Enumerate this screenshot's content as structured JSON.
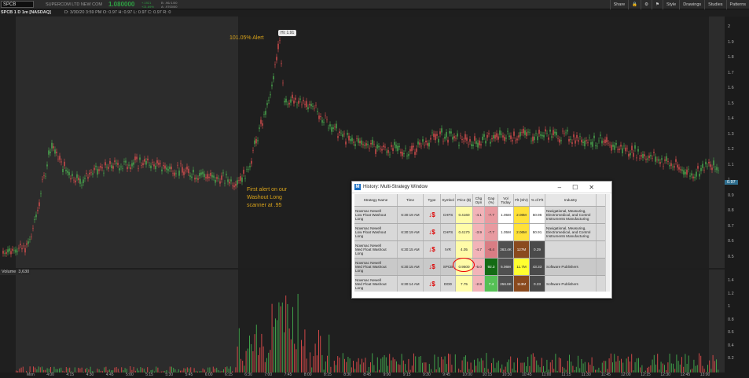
{
  "topbar": {
    "symbol": "SPCB",
    "company": "SUPERCOM LTD NEW COM",
    "price": "1.080000",
    "change_line1": "+.1921",
    "change_line2": "+21.69%",
    "extra_line1": "B: .96/.1/00",
    "extra_line2": "A: .9700/00",
    "tools": [
      "Share",
      "",
      "",
      "",
      "Style",
      "Drawings",
      "Studies",
      "Patterns"
    ]
  },
  "info": {
    "title": "SPCB 1 D 1m [NASDAQ]",
    "ohlc": "D: 3/30/20 3:59 PM   O: 0.97   H: 0.97   L: 0.97   C: 0.97   R: 0"
  },
  "price_axis": [
    "2",
    "1.9",
    "1.8",
    "1.7",
    "1.6",
    "1.5",
    "1.4",
    "1.3",
    "1.2",
    "1.1",
    "1",
    "0.9",
    "0.8",
    "0.7",
    "0.6",
    "0.5"
  ],
  "last_price_tag": "0.97",
  "volume": {
    "label": "Volume",
    "value": "3,630",
    "axis": [
      "1.4",
      "1.2",
      "1",
      "0.8",
      "0.6",
      "0.4",
      "0.2"
    ],
    "unit": "millions"
  },
  "time_axis": [
    "Mon",
    "4:00",
    "4:15",
    "4:30",
    "4:45",
    "5:00",
    "5:15",
    "5:30",
    "5:45",
    "6:00",
    "6:15",
    "6:30",
    "7:00",
    "7:45",
    "8:00",
    "8:15",
    "8:30",
    "8:45",
    "9:00",
    "9:15",
    "9:30",
    "9:45",
    "10:00",
    "10:15",
    "10:30",
    "10:45",
    "11:00",
    "11:15",
    "11:30",
    "11:45",
    "12:00",
    "12:15",
    "12:30",
    "12:45",
    "13:00"
  ],
  "annotations": {
    "alert": "101.05% Alert",
    "high": "Hi: 1.91",
    "first_alert": "First alert on our\nWashout Long\nscanner at .95",
    "left_price": "0.53"
  },
  "window": {
    "title": "History: Multi-Strategy Window",
    "headers": [
      "Strategy Name",
      "Time",
      "Type",
      "Symbol",
      "Price ($)",
      "Chg Opn",
      "Gap (%)",
      "Vol Today",
      "Flt (Shr)",
      "% of Flt",
      "Industry"
    ],
    "rows": [
      {
        "name": "Nowmac Newell\nLow Float Washout\nLong",
        "time": "6:30:19 AM",
        "symbol": "CHFS",
        "price": "0.4160",
        "chg": "-4.1",
        "gap": "-7.7",
        "vol": "1.05M",
        "flt": "2.06M",
        "pct": "50.96",
        "industry": "Navigational, Measuring, Electromedical, and Control Instruments Manufacturing"
      },
      {
        "name": "Nowmac Newell\nLow Float Washout\nLong",
        "time": "6:30:19 AM",
        "symbol": "CHFS",
        "price": "0.4170",
        "chg": "-3.9",
        "gap": "-7.7",
        "vol": "1.05M",
        "flt": "2.06M",
        "pct": "50.91",
        "industry": "Navigational, Measuring, Electromedical, and Control Instruments Manufacturing"
      },
      {
        "name": "Nowmac Newell\nMed Float Washout\nLong",
        "time": "6:30:15 AM",
        "symbol": "IVR",
        "price": "4.05",
        "chg": "-4.7",
        "gap": "-8.4",
        "vol": "363.4K",
        "flt": "127M",
        "pct": "0.29",
        "industry": ""
      },
      {
        "name": "Nowmac Newell\nMed Float Washout\nLong",
        "time": "6:30:15 AM",
        "symbol": "SPCB",
        "price": "0.9500",
        "chg": "-5.0",
        "gap": "92.3",
        "vol": "5.06M",
        "flt": "11.7M",
        "pct": "43.33",
        "industry": "Software Publishers"
      },
      {
        "name": "Nowmac Newell\nMed Float Washout\nLong",
        "time": "6:30:14 AM",
        "symbol": "DDD",
        "price": "7.75",
        "chg": "-2.8",
        "gap": "7.4",
        "vol": "256.8K",
        "flt": "113M",
        "pct": "0.23",
        "industry": "Software Publishers"
      }
    ]
  }
}
